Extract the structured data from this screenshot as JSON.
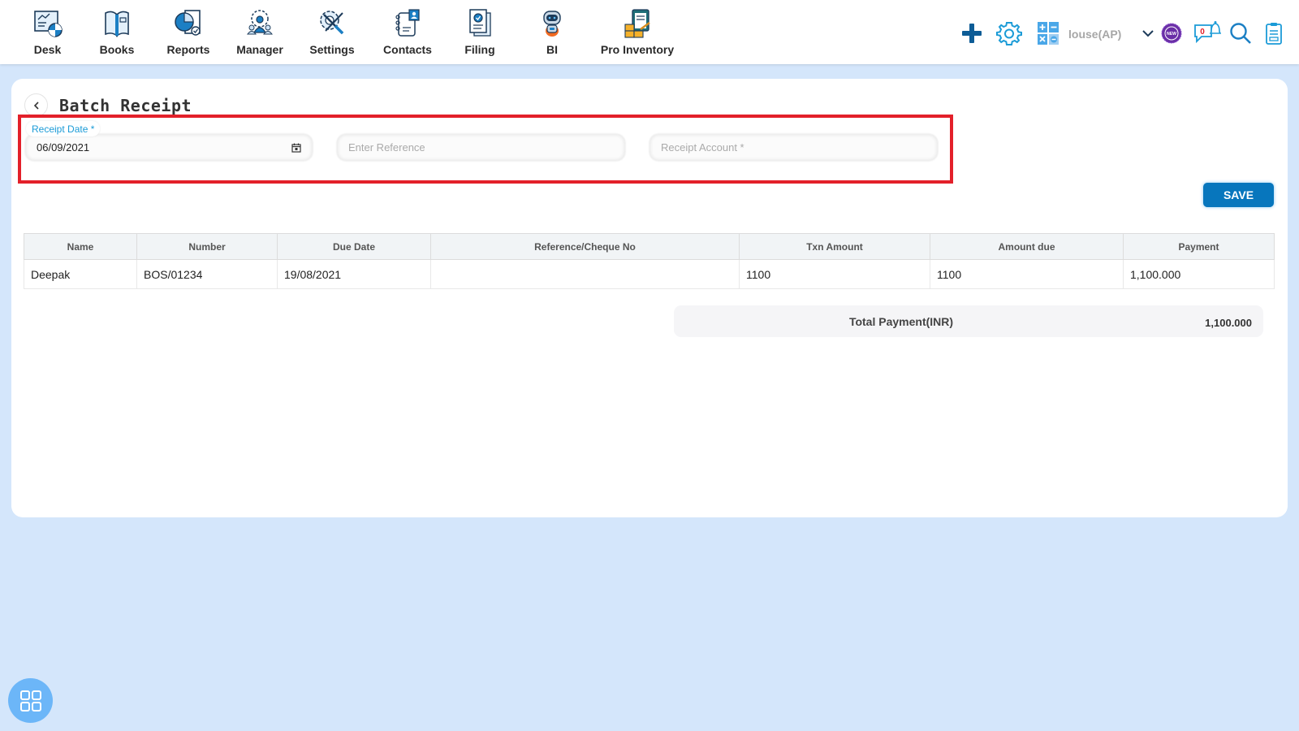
{
  "nav": {
    "items": [
      {
        "label": "Desk",
        "icon": "desk-icon"
      },
      {
        "label": "Books",
        "icon": "books-icon"
      },
      {
        "label": "Reports",
        "icon": "reports-icon"
      },
      {
        "label": "Manager",
        "icon": "manager-icon"
      },
      {
        "label": "Settings",
        "icon": "settings-tools-icon"
      },
      {
        "label": "Contacts",
        "icon": "contacts-icon"
      },
      {
        "label": "Filing",
        "icon": "filing-icon"
      },
      {
        "label": "BI",
        "icon": "robot-icon"
      },
      {
        "label": "Pro Inventory",
        "icon": "inventory-icon"
      }
    ]
  },
  "toolbar": {
    "company_name": "louse(AP)",
    "notification_count": "0",
    "new_badge": "NEW"
  },
  "page": {
    "title": "Batch Receipt"
  },
  "form": {
    "receipt_date_label": "Receipt Date *",
    "receipt_date_value": "06/09/2021",
    "reference_placeholder": "Enter Reference",
    "reference_value": "",
    "account_placeholder": "Receipt Account *",
    "account_value": ""
  },
  "actions": {
    "save_label": "SAVE"
  },
  "table": {
    "columns": [
      "Name",
      "Number",
      "Due Date",
      "Reference/Cheque No",
      "Txn Amount",
      "Amount due",
      "Payment"
    ],
    "rows": [
      {
        "name": "Deepak",
        "number": "BOS/01234",
        "due_date": "19/08/2021",
        "reference": "",
        "txn_amount": "1100",
        "amount_due": "1100",
        "payment": "1,100.000"
      }
    ]
  },
  "total": {
    "label": "Total Payment(INR)",
    "value": "1,100.000"
  },
  "colors": {
    "accent": "#0776bd",
    "highlight_border": "#e3202a",
    "label_blue": "#1b9bd7",
    "page_background": "#d4e6fb"
  }
}
